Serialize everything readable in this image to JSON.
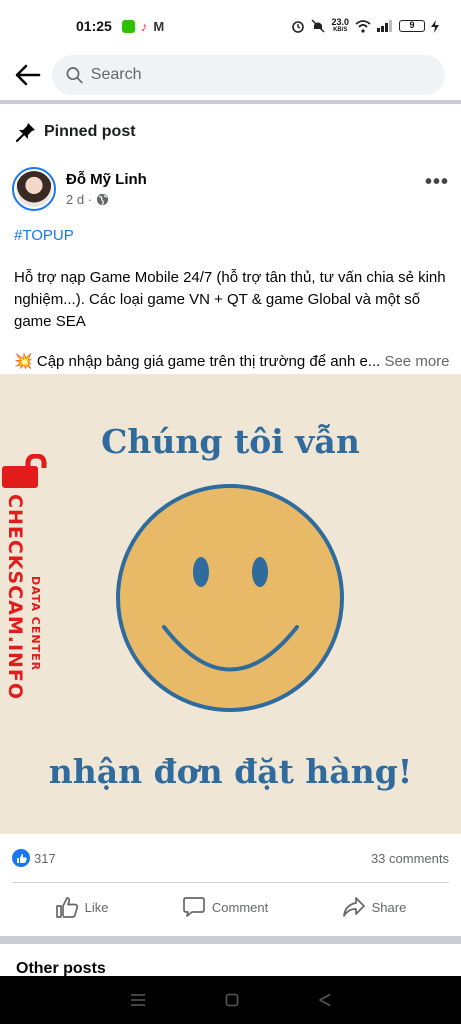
{
  "status_bar": {
    "time": "01:25",
    "net_speed_value": "23.0",
    "net_speed_unit": "KB/S",
    "battery_level": "9",
    "colors": {
      "wechat": "#2dc100",
      "tiktok": "#fe2c55",
      "gmail": "#333333"
    }
  },
  "header": {
    "search_placeholder": "Search",
    "back_icon": "arrow-left-icon",
    "search_icon": "search-icon"
  },
  "pinned": {
    "label": "Pinned post",
    "icon": "pin-icon"
  },
  "post": {
    "author": "Đỗ Mỹ Linh",
    "time": "2 d ·",
    "privacy_icon": "globe-icon",
    "hashtag": "#TOPUP",
    "text": "Hỗ trợ nạp Game Mobile 24/7 (hỗ trợ tân thủ, tư vấn chia sẻ kinh nghiệm...). Các loại game VN + QT & game Global và một số game SEA",
    "line2_emoji": "💥",
    "line2_text": " Cập nhập bảng giá game trên thị trường để anh e...",
    "see_more": " See more",
    "image": {
      "top_text": "Chúng tôi vẫn",
      "bottom_text": "nhận đơn đặt hàng!",
      "watermark_top": "DATA CENTER",
      "watermark_main": "CHECKSCAM.INFO",
      "colors": {
        "background": "#efe6d6",
        "smiley_face": "#e8ba68",
        "outline": "#2f6b9c",
        "watermark": "#e21b1b"
      }
    },
    "reactions_count": "317",
    "comments_count": "33 comments",
    "actions": {
      "like": "Like",
      "comment": "Comment",
      "share": "Share"
    }
  },
  "other_posts": {
    "label": "Other posts"
  },
  "accent_color": "#1877f2"
}
